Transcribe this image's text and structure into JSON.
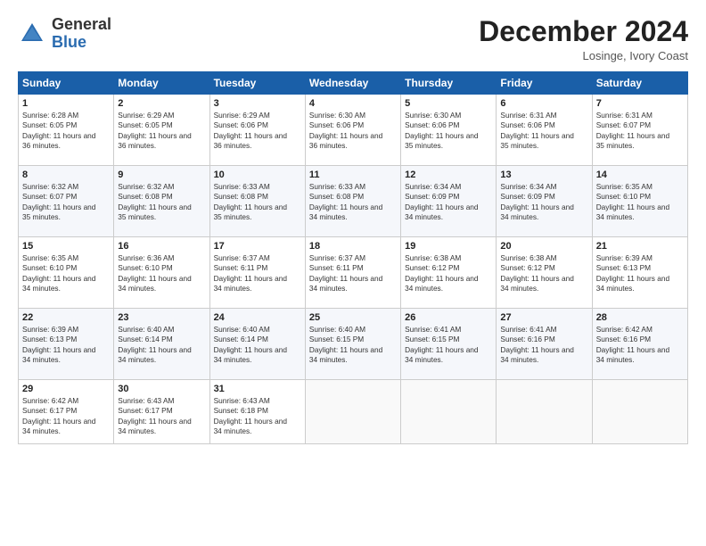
{
  "logo": {
    "line1": "General",
    "line2": "Blue"
  },
  "title": "December 2024",
  "location": "Losinge, Ivory Coast",
  "days_header": [
    "Sunday",
    "Monday",
    "Tuesday",
    "Wednesday",
    "Thursday",
    "Friday",
    "Saturday"
  ],
  "weeks": [
    [
      {
        "day": "1",
        "sunrise": "6:28 AM",
        "sunset": "6:05 PM",
        "daylight": "11 hours and 36 minutes."
      },
      {
        "day": "2",
        "sunrise": "6:29 AM",
        "sunset": "6:05 PM",
        "daylight": "11 hours and 36 minutes."
      },
      {
        "day": "3",
        "sunrise": "6:29 AM",
        "sunset": "6:06 PM",
        "daylight": "11 hours and 36 minutes."
      },
      {
        "day": "4",
        "sunrise": "6:30 AM",
        "sunset": "6:06 PM",
        "daylight": "11 hours and 36 minutes."
      },
      {
        "day": "5",
        "sunrise": "6:30 AM",
        "sunset": "6:06 PM",
        "daylight": "11 hours and 35 minutes."
      },
      {
        "day": "6",
        "sunrise": "6:31 AM",
        "sunset": "6:06 PM",
        "daylight": "11 hours and 35 minutes."
      },
      {
        "day": "7",
        "sunrise": "6:31 AM",
        "sunset": "6:07 PM",
        "daylight": "11 hours and 35 minutes."
      }
    ],
    [
      {
        "day": "8",
        "sunrise": "6:32 AM",
        "sunset": "6:07 PM",
        "daylight": "11 hours and 35 minutes."
      },
      {
        "day": "9",
        "sunrise": "6:32 AM",
        "sunset": "6:08 PM",
        "daylight": "11 hours and 35 minutes."
      },
      {
        "day": "10",
        "sunrise": "6:33 AM",
        "sunset": "6:08 PM",
        "daylight": "11 hours and 35 minutes."
      },
      {
        "day": "11",
        "sunrise": "6:33 AM",
        "sunset": "6:08 PM",
        "daylight": "11 hours and 34 minutes."
      },
      {
        "day": "12",
        "sunrise": "6:34 AM",
        "sunset": "6:09 PM",
        "daylight": "11 hours and 34 minutes."
      },
      {
        "day": "13",
        "sunrise": "6:34 AM",
        "sunset": "6:09 PM",
        "daylight": "11 hours and 34 minutes."
      },
      {
        "day": "14",
        "sunrise": "6:35 AM",
        "sunset": "6:10 PM",
        "daylight": "11 hours and 34 minutes."
      }
    ],
    [
      {
        "day": "15",
        "sunrise": "6:35 AM",
        "sunset": "6:10 PM",
        "daylight": "11 hours and 34 minutes."
      },
      {
        "day": "16",
        "sunrise": "6:36 AM",
        "sunset": "6:10 PM",
        "daylight": "11 hours and 34 minutes."
      },
      {
        "day": "17",
        "sunrise": "6:37 AM",
        "sunset": "6:11 PM",
        "daylight": "11 hours and 34 minutes."
      },
      {
        "day": "18",
        "sunrise": "6:37 AM",
        "sunset": "6:11 PM",
        "daylight": "11 hours and 34 minutes."
      },
      {
        "day": "19",
        "sunrise": "6:38 AM",
        "sunset": "6:12 PM",
        "daylight": "11 hours and 34 minutes."
      },
      {
        "day": "20",
        "sunrise": "6:38 AM",
        "sunset": "6:12 PM",
        "daylight": "11 hours and 34 minutes."
      },
      {
        "day": "21",
        "sunrise": "6:39 AM",
        "sunset": "6:13 PM",
        "daylight": "11 hours and 34 minutes."
      }
    ],
    [
      {
        "day": "22",
        "sunrise": "6:39 AM",
        "sunset": "6:13 PM",
        "daylight": "11 hours and 34 minutes."
      },
      {
        "day": "23",
        "sunrise": "6:40 AM",
        "sunset": "6:14 PM",
        "daylight": "11 hours and 34 minutes."
      },
      {
        "day": "24",
        "sunrise": "6:40 AM",
        "sunset": "6:14 PM",
        "daylight": "11 hours and 34 minutes."
      },
      {
        "day": "25",
        "sunrise": "6:40 AM",
        "sunset": "6:15 PM",
        "daylight": "11 hours and 34 minutes."
      },
      {
        "day": "26",
        "sunrise": "6:41 AM",
        "sunset": "6:15 PM",
        "daylight": "11 hours and 34 minutes."
      },
      {
        "day": "27",
        "sunrise": "6:41 AM",
        "sunset": "6:16 PM",
        "daylight": "11 hours and 34 minutes."
      },
      {
        "day": "28",
        "sunrise": "6:42 AM",
        "sunset": "6:16 PM",
        "daylight": "11 hours and 34 minutes."
      }
    ],
    [
      {
        "day": "29",
        "sunrise": "6:42 AM",
        "sunset": "6:17 PM",
        "daylight": "11 hours and 34 minutes."
      },
      {
        "day": "30",
        "sunrise": "6:43 AM",
        "sunset": "6:17 PM",
        "daylight": "11 hours and 34 minutes."
      },
      {
        "day": "31",
        "sunrise": "6:43 AM",
        "sunset": "6:18 PM",
        "daylight": "11 hours and 34 minutes."
      },
      null,
      null,
      null,
      null
    ]
  ]
}
